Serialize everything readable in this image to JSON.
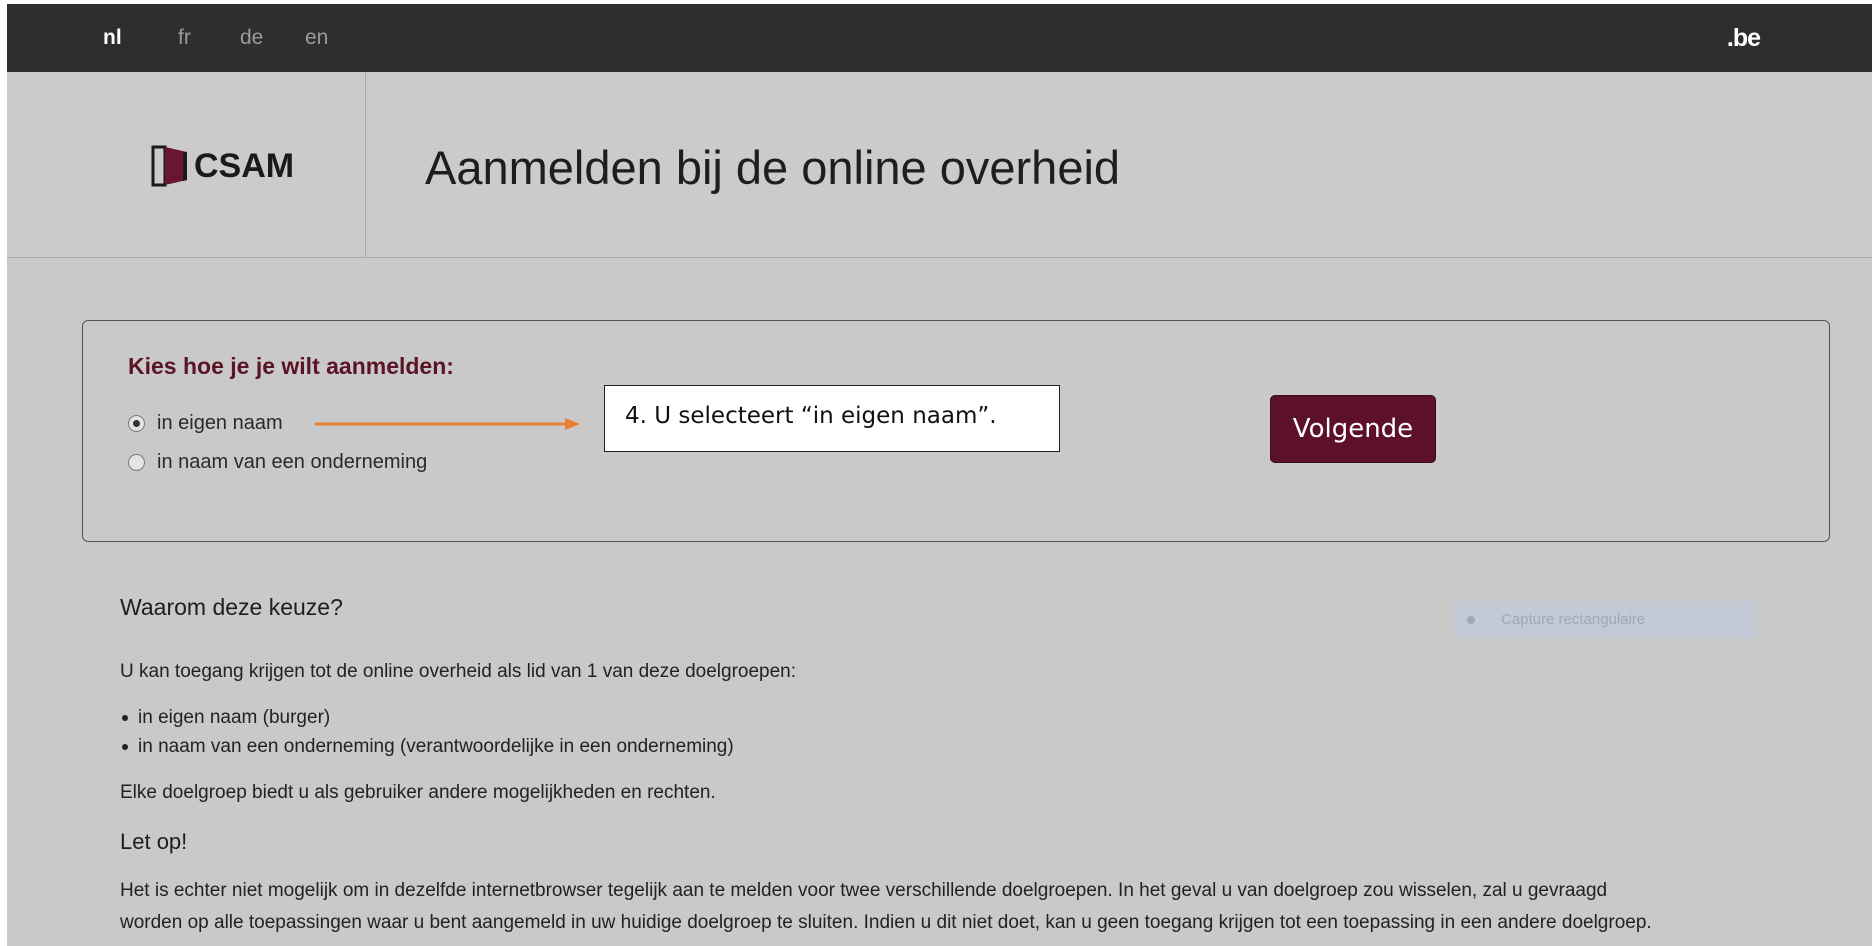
{
  "languages": [
    "nl",
    "fr",
    "de",
    "en"
  ],
  "active_language": "nl",
  "brand_right": ".be",
  "logo_text": "CSAM",
  "page_title": "Aanmelden bij de online overheid",
  "choice": {
    "heading": "Kies hoe je je wilt aanmelden:",
    "options": [
      {
        "label": "in eigen naam",
        "checked": true
      },
      {
        "label": "in naam van een onderneming",
        "checked": false
      }
    ],
    "next_button": "Volgende"
  },
  "annotation": {
    "callout_text": "4. U selecteert “in eigen naam”.",
    "arrow_color": "#ed7d31"
  },
  "info": {
    "why_heading": "Waarom deze keuze?",
    "intro": "U kan toegang krijgen tot de online overheid als lid van 1 van deze doelgroepen:",
    "groups": [
      "in eigen naam (burger)",
      "in naam van een onderneming (verantwoordelijke in een onderneming)"
    ],
    "rights": "Elke doelgroep biedt u als gebruiker andere mogelijkheden en rechten.",
    "note_heading": "Let op!",
    "note_line1": "Het is echter niet mogelijk om in dezelfde internetbrowser tegelijk aan te melden voor twee verschillende doelgroepen. In het geval u van doelgroep zou wisselen, zal u gevraagd",
    "note_line2": "worden op alle toepassingen waar u bent aangemeld in uw huidige doelgroep te sluiten. Indien u dit niet doet, kan u geen toegang krijgen tot een toepassing in een andere doelgroep."
  },
  "overlay_ghost": "Capture rectangulaire",
  "colors": {
    "topbar": "#2e2e2e",
    "accent": "#5c1128",
    "background": "#c9c9c9"
  }
}
